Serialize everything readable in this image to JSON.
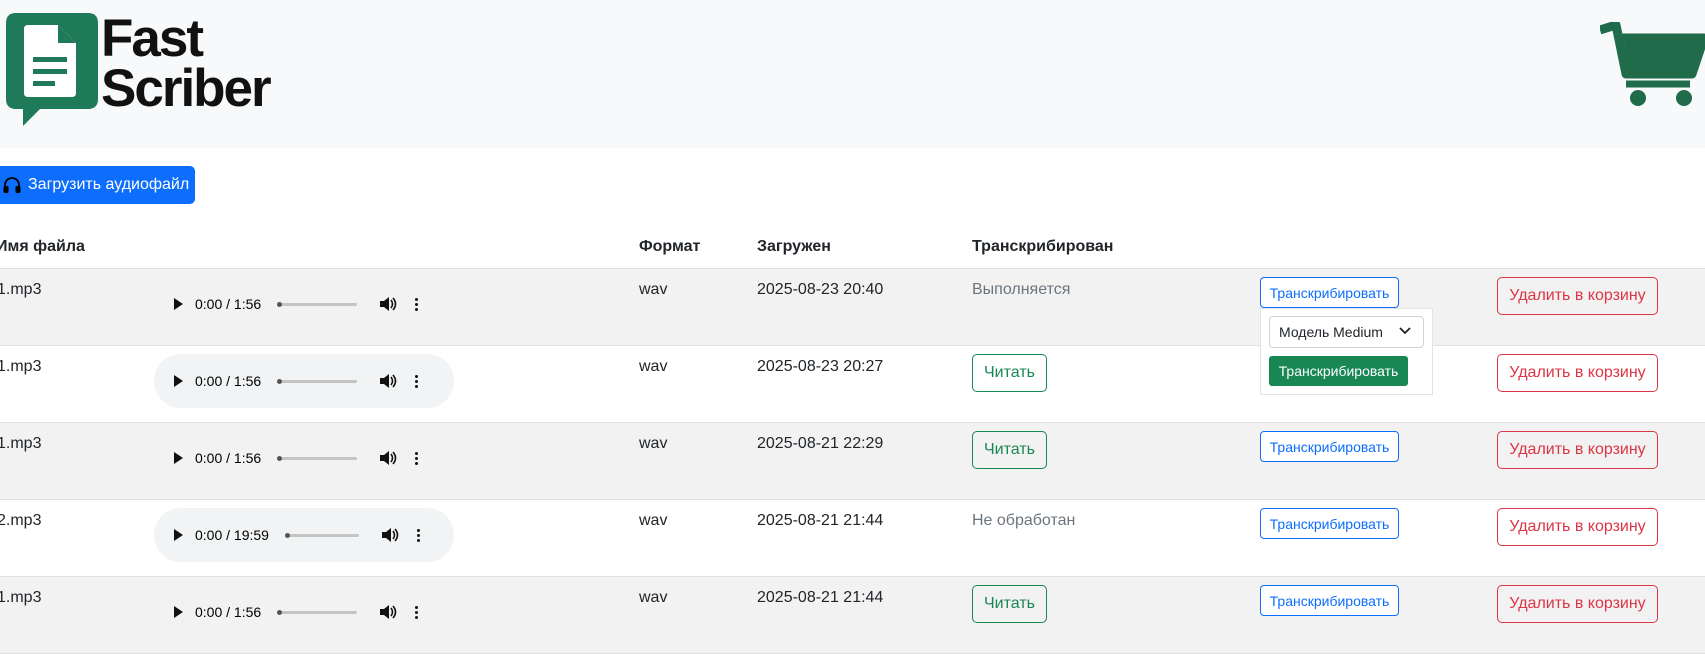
{
  "brand": {
    "line1": "Fast",
    "line2": "Scriber"
  },
  "toolbar": {
    "upload_label": "Загрузить аудиофайл"
  },
  "table": {
    "headers": {
      "name": "Имя файла",
      "format": "Формат",
      "uploaded": "Загружен",
      "transcribed": "Транскрибирован"
    },
    "rows": [
      {
        "name": "1.mp3",
        "time": "0:00 / 1:56",
        "format": "wav",
        "uploaded": "2025-08-23 20:40",
        "status": "Выполняется",
        "read": "",
        "transcribe": "Транскрибировать",
        "delete": "Удалить в корзину"
      },
      {
        "name": "1.mp3",
        "time": "0:00 / 1:56",
        "format": "wav",
        "uploaded": "2025-08-23 20:27",
        "status": "",
        "read": "Читать",
        "transcribe": "",
        "delete": "Удалить в корзину"
      },
      {
        "name": "1.mp3",
        "time": "0:00 / 1:56",
        "format": "wav",
        "uploaded": "2025-08-21 22:29",
        "status": "",
        "read": "Читать",
        "transcribe": "Транскрибировать",
        "delete": "Удалить в корзину"
      },
      {
        "name": "2.mp3",
        "time": "0:00 / 19:59",
        "format": "wav",
        "uploaded": "2025-08-21 21:44",
        "status": "Не обработан",
        "read": "",
        "transcribe": "Транскрибировать",
        "delete": "Удалить в корзину"
      },
      {
        "name": "1.mp3",
        "time": "0:00 / 1:56",
        "format": "wav",
        "uploaded": "2025-08-21 21:44",
        "status": "",
        "read": "Читать",
        "transcribe": "Транскрибировать",
        "delete": "Удалить в корзину"
      }
    ]
  },
  "dropdown": {
    "model_selected": "Модель Medium",
    "submit_label": "Транскрибировать"
  },
  "colors": {
    "brand_green": "#1f7a5a",
    "primary": "#0d6efd",
    "success": "#198754",
    "danger": "#dc3545"
  }
}
